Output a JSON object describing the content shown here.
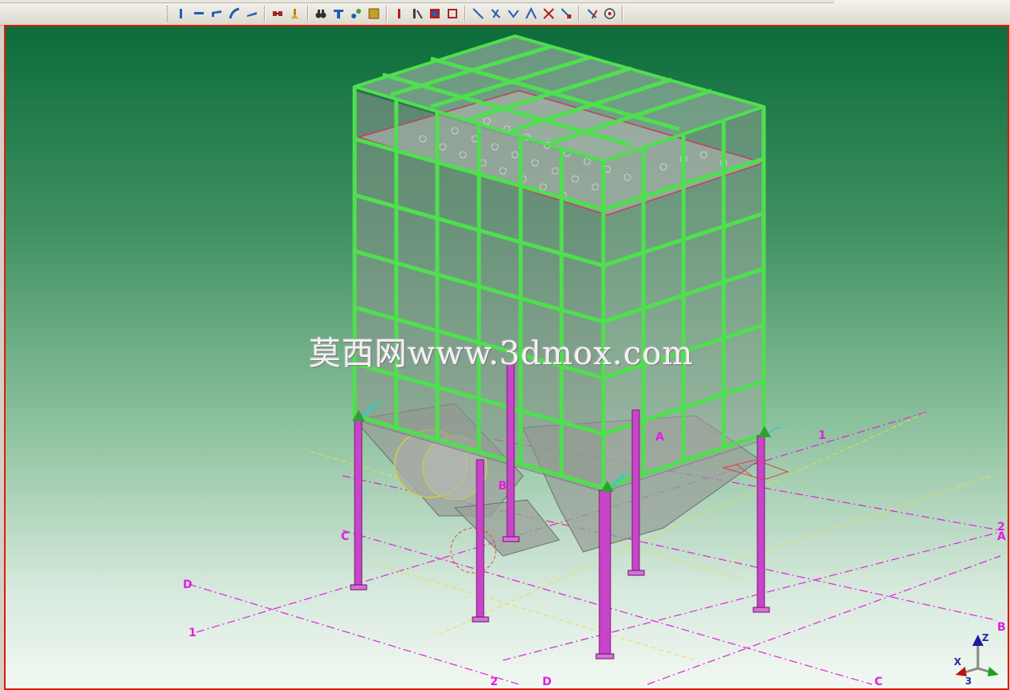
{
  "toolbar": {
    "tools": [
      {
        "icon": "column-icon",
        "color": "#1e5fb8"
      },
      {
        "icon": "beam-icon",
        "color": "#1e5fb8"
      },
      {
        "icon": "bent-beam-icon",
        "color": "#1e5fb8"
      },
      {
        "icon": "curved-beam-icon",
        "color": "#1e5fb8"
      },
      {
        "icon": "brace-icon",
        "color": "#1e5fb8"
      },
      {
        "icon": "connection-icon",
        "color": "#b02020"
      },
      {
        "icon": "fitting-icon",
        "color": "#c08010"
      },
      {
        "icon": "binoculars-icon",
        "color": "#303030"
      },
      {
        "icon": "section-icon",
        "color": "#1e5fb8"
      },
      {
        "icon": "node-icon",
        "color": "#1e5fb8"
      },
      {
        "icon": "plate-icon",
        "color": "#c8a020"
      },
      {
        "icon": "weld-icon",
        "color": "#b02020"
      },
      {
        "icon": "cut-icon",
        "color": "#404040"
      },
      {
        "icon": "fill-icon",
        "color": "#b02020"
      },
      {
        "icon": "marker-icon",
        "color": "#b02020"
      },
      {
        "icon": "line-icon",
        "color": "#1e5fb8"
      },
      {
        "icon": "dimension-icon",
        "color": "#1e5fb8"
      },
      {
        "icon": "dimension-2-icon",
        "color": "#1e5fb8"
      },
      {
        "icon": "angle-icon",
        "color": "#1e5fb8"
      },
      {
        "icon": "angle-2-icon",
        "color": "#b02020"
      },
      {
        "icon": "point-icon",
        "color": "#b02020"
      },
      {
        "icon": "snap-icon",
        "color": "#b02020"
      },
      {
        "icon": "target-icon",
        "color": "#404040"
      }
    ]
  },
  "viewport": {
    "border_color": "#e01a0a",
    "frame_color": "#4ee04e",
    "column_color": "#c844c8",
    "grid_line_color": "#e020e0",
    "watermark": "莫西网www.3dmox.com",
    "grid_labels": {
      "a_top": "A",
      "b_mid": "B",
      "c_left": "C",
      "d_left": "D",
      "one_left": "1",
      "one_right": "1",
      "two_right": "2",
      "a_right": "A",
      "b_right": "B",
      "two_bottom": "2",
      "d_bottom": "D",
      "c_bottom": "C"
    },
    "triad": {
      "z": "Z",
      "x": "X",
      "y": "3"
    }
  }
}
